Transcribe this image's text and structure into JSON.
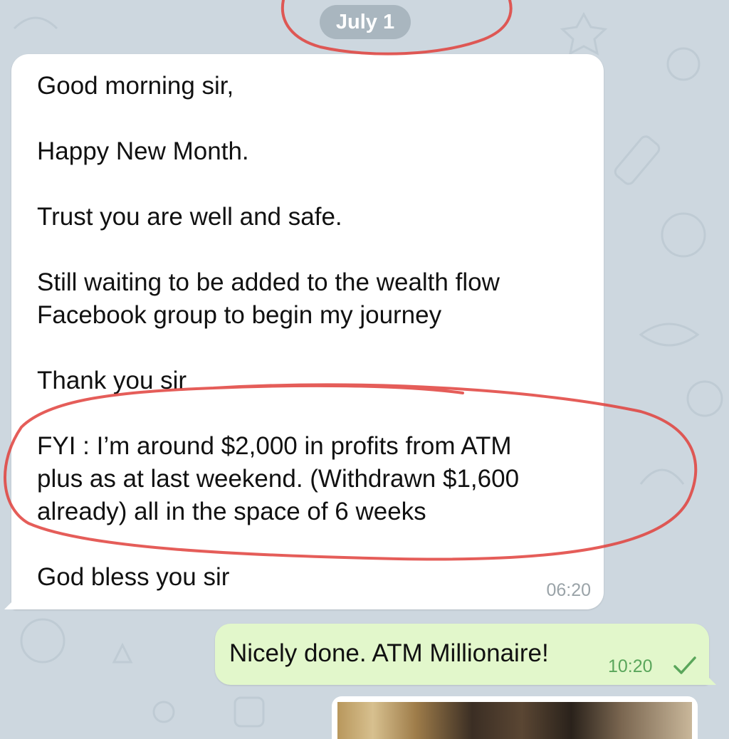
{
  "chat": {
    "date_label": "July 1",
    "incoming": {
      "paragraphs": [
        "Good morning sir,",
        "Happy New Month.",
        "Trust you are well and safe.",
        "Still waiting to be added to the wealth flow\nFacebook group to begin my journey",
        "Thank you sir",
        "FYI : I’m around $2,000 in profits from ATM\nplus as at last weekend. (Withdrawn $1,600\nalready) all in the space of 6 weeks",
        "God bless you sir"
      ],
      "time": "06:20"
    },
    "outgoing": {
      "text": "Nicely done. ATM Millionaire!",
      "time": "10:20",
      "status_icon": "check-icon"
    },
    "photo_message": {
      "icon": "photo-thumbnail"
    }
  },
  "colors": {
    "background": "#cdd7df",
    "incoming_bubble": "#ffffff",
    "outgoing_bubble": "#e2f7cb",
    "outgoing_time": "#5aa65b",
    "annotation_circle": "#e0413c"
  }
}
